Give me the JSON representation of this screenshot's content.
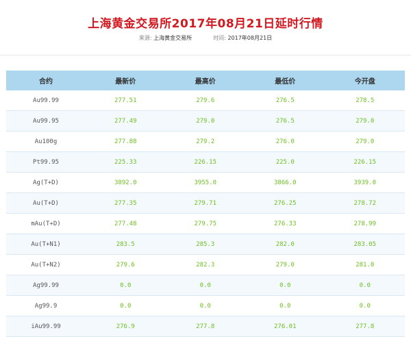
{
  "header": {
    "title": "上海黄金交易所2017年08月21日延时行情",
    "source_label": "来源:",
    "source_value": "上海黄金交易所",
    "time_label": "时间:",
    "time_value": "2017年08月21日"
  },
  "table": {
    "columns": [
      "合约",
      "最新价",
      "最高价",
      "最低价",
      "今开盘"
    ],
    "rows": [
      [
        "Au99.99",
        "277.51",
        "279.6",
        "276.5",
        "278.5"
      ],
      [
        "Au99.95",
        "277.49",
        "279.0",
        "276.5",
        "279.0"
      ],
      [
        "Au100g",
        "277.88",
        "279.2",
        "276.0",
        "279.0"
      ],
      [
        "Pt99.95",
        "225.33",
        "226.15",
        "225.0",
        "226.15"
      ],
      [
        "Ag(T+D)",
        "3892.0",
        "3955.0",
        "3866.0",
        "3939.0"
      ],
      [
        "Au(T+D)",
        "277.35",
        "279.71",
        "276.25",
        "278.72"
      ],
      [
        "mAu(T+D)",
        "277.48",
        "279.75",
        "276.33",
        "278.99"
      ],
      [
        "Au(T+N1)",
        "283.5",
        "285.3",
        "282.0",
        "283.05"
      ],
      [
        "Au(T+N2)",
        "279.6",
        "282.3",
        "279.0",
        "281.0"
      ],
      [
        "Ag99.99",
        "0.0",
        "0.0",
        "0.0",
        "0.0"
      ],
      [
        "Ag99.9",
        "0.0",
        "0.0",
        "0.0",
        "0.0"
      ],
      [
        "iAu99.99",
        "276.9",
        "277.8",
        "276.01",
        "277.8"
      ]
    ]
  },
  "colors": {
    "title": "#d01920",
    "header_bg": "#add6ef",
    "value_text": "#6cbf1f"
  }
}
